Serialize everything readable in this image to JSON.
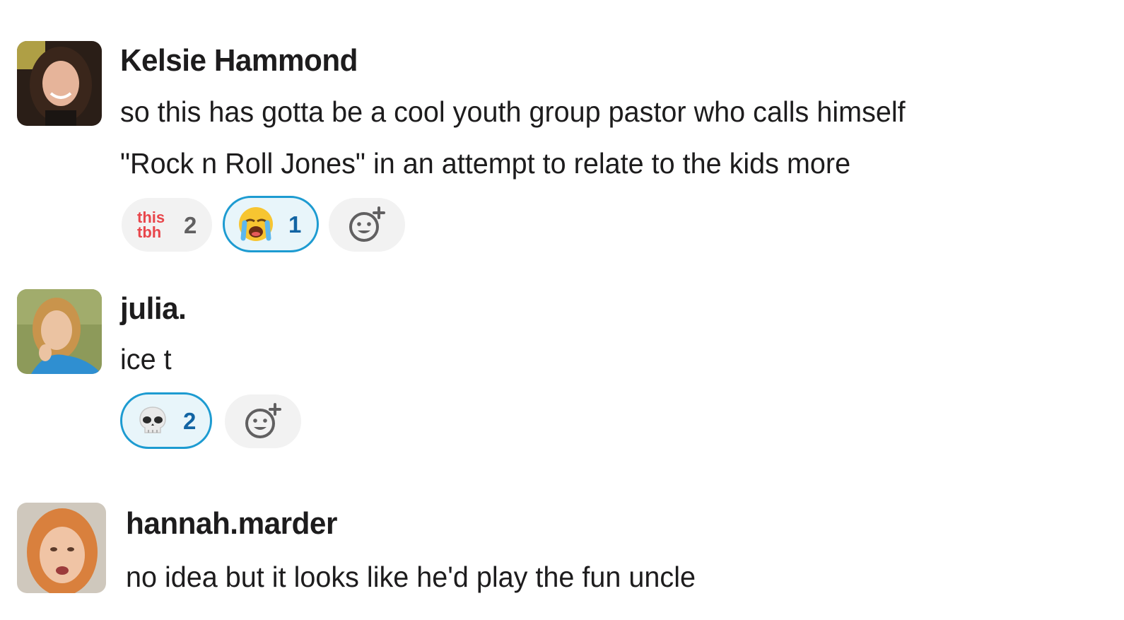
{
  "messages": [
    {
      "author": "Kelsie Hammond",
      "lines": [
        "so this has gotta be a cool youth group pastor who calls himself",
        "\"Rock n Roll Jones\" in an attempt to relate to the kids more"
      ],
      "reactions": [
        {
          "emoji_label_line1": "this",
          "emoji_label_line2": "tbh",
          "icon": "this-tbh-emoji",
          "count": "2",
          "selected": false
        },
        {
          "icon": "loudly-crying-face-icon",
          "count": "1",
          "selected": true
        }
      ]
    },
    {
      "author": "julia.",
      "lines": [
        "ice t"
      ],
      "reactions": [
        {
          "icon": "skull-icon",
          "count": "2",
          "selected": true
        }
      ]
    },
    {
      "author": "hannah.marder",
      "lines": [
        "no idea but it looks like he'd play the fun uncle"
      ]
    }
  ],
  "colors": {
    "selected_border": "#1d9bd1",
    "selected_bg": "#e8f5fa",
    "selected_count": "#1264a3",
    "pill_bg": "#f2f2f2",
    "this_tbh_red": "#e8464b"
  }
}
